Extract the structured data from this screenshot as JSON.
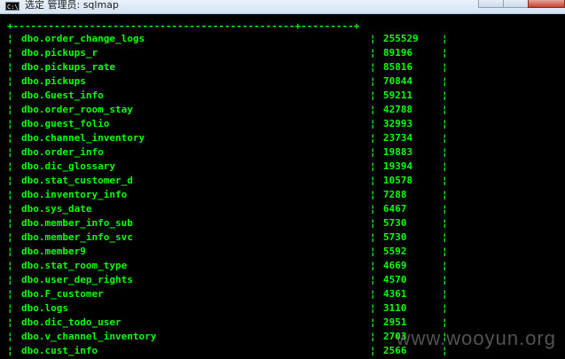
{
  "window": {
    "title": "选定 管理员: sqlmap",
    "icon_label": "C:\\."
  },
  "table": {
    "border": "+------------------------------------------------+---------+",
    "rows": [
      {
        "name": "dbo.order_change_logs",
        "count": "255529"
      },
      {
        "name": "dbo.pickups_r",
        "count": "89196"
      },
      {
        "name": "dbo.pickups_rate",
        "count": "85816"
      },
      {
        "name": "dbo.pickups",
        "count": "70844"
      },
      {
        "name": "dbo.Guest_info",
        "count": "59211"
      },
      {
        "name": "dbo.order_room_stay",
        "count": "42788"
      },
      {
        "name": "dbo.guest_folio",
        "count": "32993"
      },
      {
        "name": "dbo.channel_inventory",
        "count": "23734"
      },
      {
        "name": "dbo.order_info",
        "count": "19883"
      },
      {
        "name": "dbo.dic_glossary",
        "count": "19394"
      },
      {
        "name": "dbo.stat_customer_d",
        "count": "10578"
      },
      {
        "name": "dbo.inventory_info",
        "count": "7288"
      },
      {
        "name": "dbo.sys_date",
        "count": "6467"
      },
      {
        "name": "dbo.member_info_sub",
        "count": "5730"
      },
      {
        "name": "dbo.member_info_svc",
        "count": "5730"
      },
      {
        "name": "dbo.member9",
        "count": "5592"
      },
      {
        "name": "dbo.stat_room_type",
        "count": "4669"
      },
      {
        "name": "dbo.user_dep_rights",
        "count": "4570"
      },
      {
        "name": "dbo.F_customer",
        "count": "4361"
      },
      {
        "name": "dbo.logs",
        "count": "3110"
      },
      {
        "name": "dbo.dic_todo_user",
        "count": "2951"
      },
      {
        "name": "dbo.v_channel_inventory",
        "count": "2703"
      },
      {
        "name": "dbo.cust_info",
        "count": "2566"
      }
    ]
  },
  "watermark": "www.wooyun.org",
  "colors": {
    "text": "#00ff00",
    "background": "#000000"
  }
}
